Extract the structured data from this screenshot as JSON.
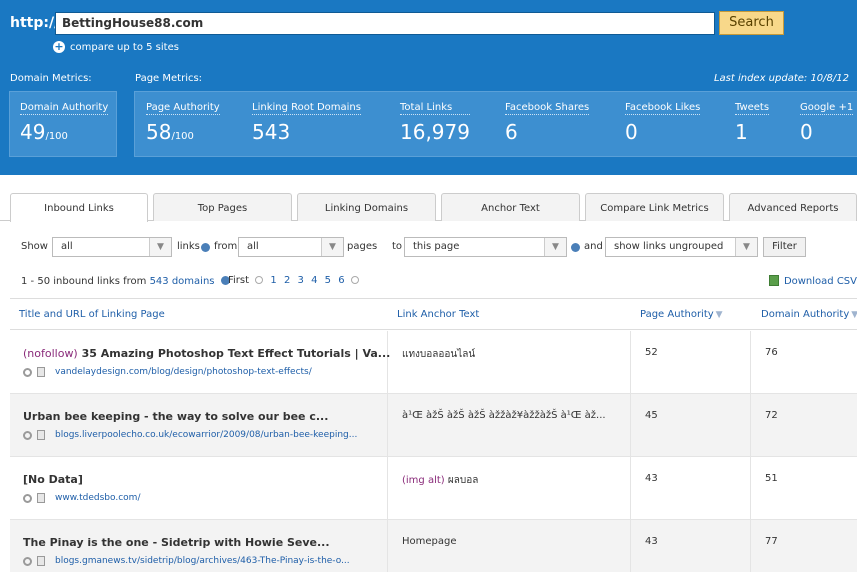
{
  "search": {
    "prefix": "http://",
    "value": "BettingHouse88.com",
    "button_label": "Search",
    "compare_label": "compare up to 5 sites"
  },
  "metrics": {
    "domain_section_label": "Domain Metrics:",
    "page_section_label": "Page Metrics:",
    "last_index": "Last index update: 10/8/12",
    "domain_authority": {
      "label": "Domain Authority",
      "value": "49",
      "suffix": "/100"
    },
    "page": [
      {
        "label": "Page Authority",
        "value": "58",
        "suffix": "/100"
      },
      {
        "label": "Linking Root Domains",
        "value": "543"
      },
      {
        "label": "Total Links",
        "value": "16,979"
      },
      {
        "label": "Facebook Shares",
        "value": "6"
      },
      {
        "label": "Facebook Likes",
        "value": "0"
      },
      {
        "label": "Tweets",
        "value": "1"
      },
      {
        "label": "Google +1",
        "value": "0"
      }
    ]
  },
  "tabs": [
    "Inbound Links",
    "Top Pages",
    "Linking Domains",
    "Anchor Text",
    "Compare Link Metrics",
    "Advanced Reports"
  ],
  "filters": {
    "show_label": "Show",
    "show_value": "all",
    "links_label": "links",
    "from_label": "from",
    "from_value": "all",
    "pages_label": "pages",
    "to_label": "to",
    "to_value": "this page",
    "and_label": "and",
    "group_value": "show links ungrouped",
    "filter_button": "Filter"
  },
  "info": {
    "range_text": "1 - 50 inbound links from",
    "domains_link": "543 domains",
    "first_label": "First",
    "pages": [
      "1",
      "2",
      "3",
      "4",
      "5",
      "6"
    ],
    "download_label": "Download CSV"
  },
  "table": {
    "headers": {
      "title": "Title and URL of Linking Page",
      "anchor": "Link Anchor Text",
      "pa": "Page Authority",
      "da": "Domain Authority"
    },
    "rows": [
      {
        "prefix": "(nofollow)",
        "title": "35 Amazing Photoshop Text Effect Tutorials | Va...",
        "url": "vandelaydesign.com/blog/design/photoshop-text-effects/",
        "anchor_prefix": "",
        "anchor": "แทงบอลออนไลน์",
        "pa": "52",
        "da": "76"
      },
      {
        "prefix": "",
        "title": "Urban bee keeping - the way to solve our bee c...",
        "url": "blogs.liverpoolecho.co.uk/ecowarrior/2009/08/urban-bee-keeping...",
        "anchor_prefix": "",
        "anchor": "à¹Œ àžŠ àžŠ àžŠ àžžàž¥àžžàžŠ à¹Œ àž...",
        "pa": "45",
        "da": "72"
      },
      {
        "prefix": "",
        "title": "[No Data]",
        "url": "www.tdedsbo.com/",
        "anchor_prefix": "(img alt)",
        "anchor": "ผลบอล",
        "pa": "43",
        "da": "51"
      },
      {
        "prefix": "",
        "title": "The Pinay is the one - Sidetrip with Howie Seve...",
        "url": "blogs.gmanews.tv/sidetrip/blog/archives/463-The-Pinay-is-the-o...",
        "anchor_prefix": "",
        "anchor": "Homepage",
        "pa": "43",
        "da": "77"
      }
    ]
  }
}
